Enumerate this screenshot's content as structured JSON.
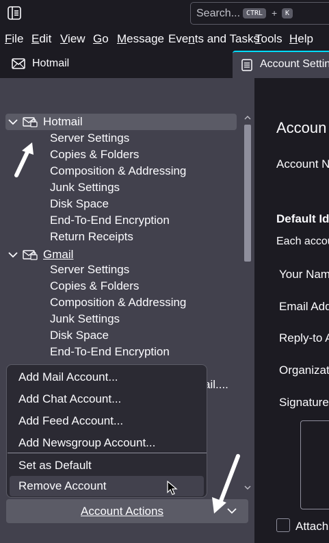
{
  "search": {
    "placeholder": "Search...",
    "kbd_mod": "CTRL",
    "kbd_plus": "+",
    "kbd_key": "K"
  },
  "menubar": [
    {
      "label": "File",
      "underline": "F",
      "rest": "ile"
    },
    {
      "label": "Edit",
      "underline": "E",
      "rest": "dit"
    },
    {
      "label": "View",
      "underline": "V",
      "rest": "iew"
    },
    {
      "label": "Go",
      "underline": "G",
      "rest": "o"
    },
    {
      "label": "Message",
      "underline": "M",
      "rest": "essage"
    },
    {
      "label": "Events and Tasks",
      "pre": "Eve",
      "underline": "n",
      "rest": "ts and Tasks"
    },
    {
      "label": "Tools",
      "underline": "T",
      "rest": "ools"
    },
    {
      "label": "Help",
      "underline": "H",
      "rest": "elp"
    }
  ],
  "tabs": {
    "hotmail": "Hotmail",
    "settings": "Account Settings"
  },
  "tree": {
    "hotmail": {
      "label": "Hotmail",
      "items": [
        "Server Settings",
        "Copies & Folders",
        "Composition & Addressing",
        "Junk Settings",
        "Disk Space",
        "End-To-End Encryption",
        "Return Receipts"
      ]
    },
    "gmail": {
      "label": "Gmail",
      "items": [
        "Server Settings",
        "Copies & Folders",
        "Composition & Addressing",
        "Junk Settings",
        "Disk Space",
        "End-To-End Encryption"
      ]
    },
    "partial_row": "ail...."
  },
  "popup": {
    "add_mail": "Add Mail Account...",
    "add_chat": "Add Chat Account...",
    "add_feed": "Add Feed Account...",
    "add_newsgroup": "Add Newsgroup Account...",
    "set_default": "Set as Default",
    "remove": "Remove Account"
  },
  "actions_button": "Account Actions",
  "right_pane": {
    "heading": "Accoun",
    "account_name": "Account N",
    "default_identity": "Default Id",
    "each_account": "Each accou",
    "your_name": "Your Nam",
    "email_address": "Email Add",
    "reply_to": "Reply-to A",
    "organization": "Organizat",
    "signature": "Signature",
    "attach": "Attach"
  },
  "colors": {
    "accent": "#00ddff",
    "pane": "#42414d",
    "background": "#1c1b22"
  }
}
